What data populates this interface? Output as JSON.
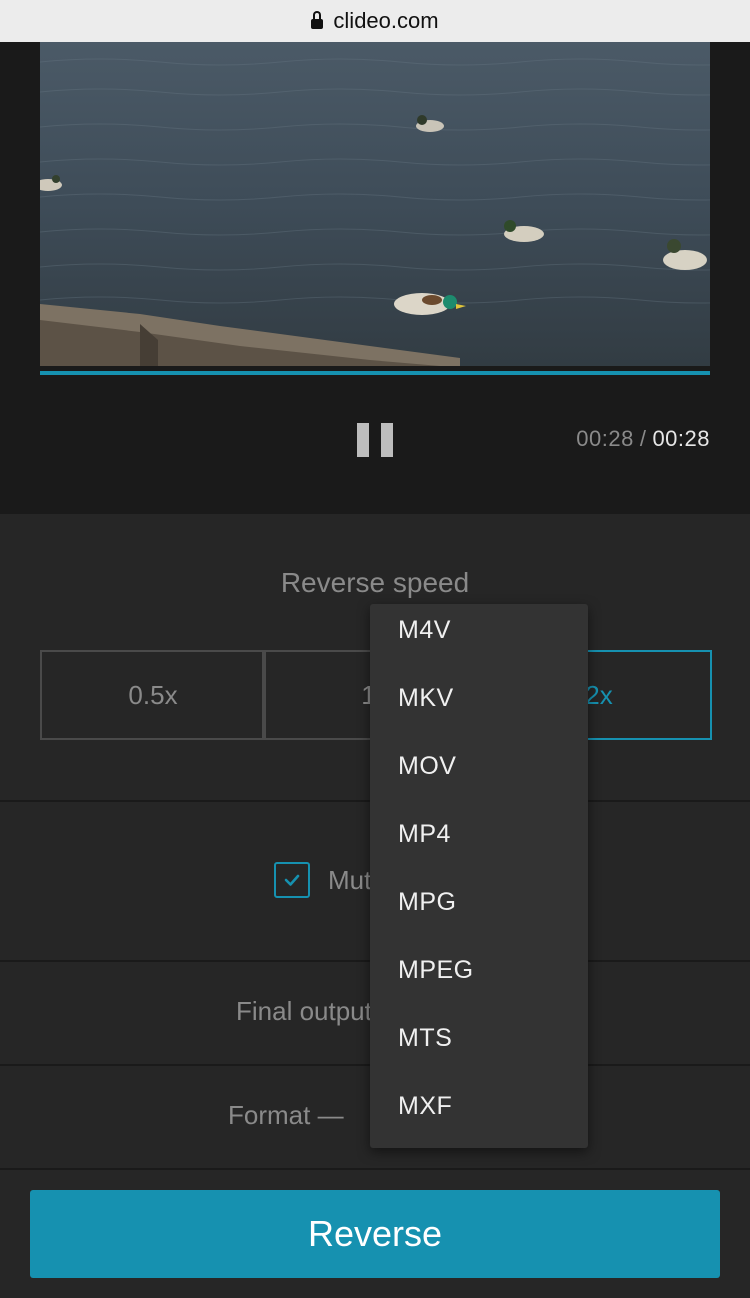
{
  "browser": {
    "url": "clideo.com"
  },
  "player": {
    "time_current": "00:28",
    "time_separator": "/",
    "time_duration": "00:28",
    "progress": 1.0
  },
  "speed": {
    "title": "Reverse speed",
    "options": [
      "0.5x",
      "1x",
      "2x"
    ],
    "selected": "2x"
  },
  "mute": {
    "label": "Mute video",
    "checked": true
  },
  "final_output": {
    "label": "Final output"
  },
  "format": {
    "label": "Format —"
  },
  "format_dropdown": {
    "items": [
      "M4V",
      "MKV",
      "MOV",
      "MP4",
      "MPG",
      "MPEG",
      "MTS",
      "MXF"
    ]
  },
  "action": {
    "reverse_label": "Reverse"
  },
  "colors": {
    "accent": "#1691b0",
    "background": "#1b1b1b",
    "panel": "#262626",
    "dropdown": "#333333"
  }
}
